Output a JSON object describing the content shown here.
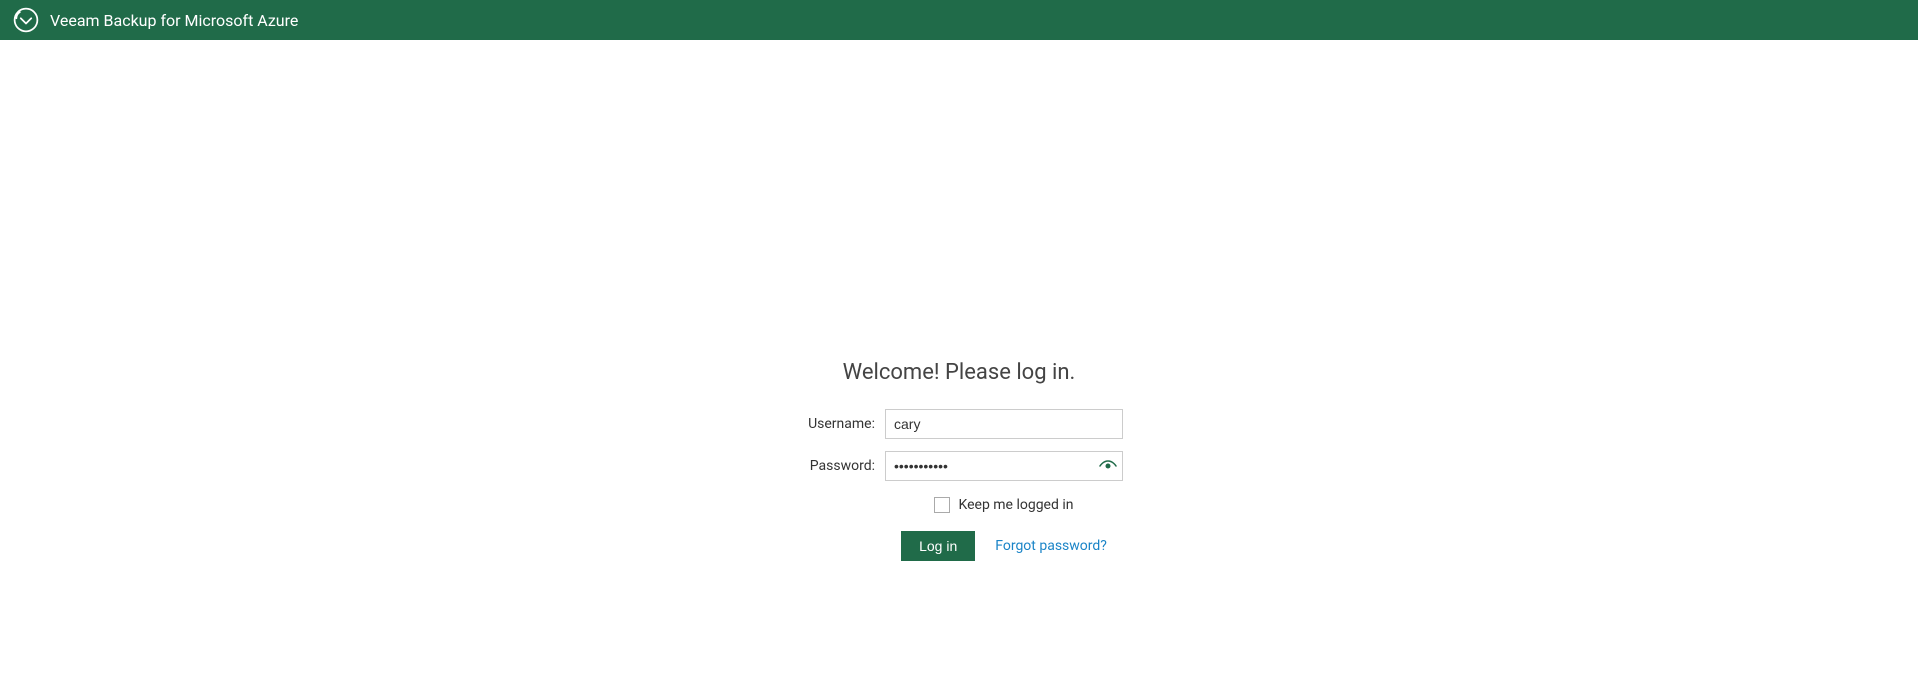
{
  "header": {
    "title": "Veeam Backup for Microsoft Azure"
  },
  "login": {
    "welcome": "Welcome! Please log in.",
    "username_label": "Username:",
    "username_value": "cary",
    "password_label": "Password:",
    "password_value": "•••••••••••",
    "keep_logged_in_label": "Keep me logged in",
    "login_button": "Log in",
    "forgot_password": "Forgot password?"
  },
  "colors": {
    "brand_green": "#206b49",
    "link_blue": "#1a84c7"
  }
}
